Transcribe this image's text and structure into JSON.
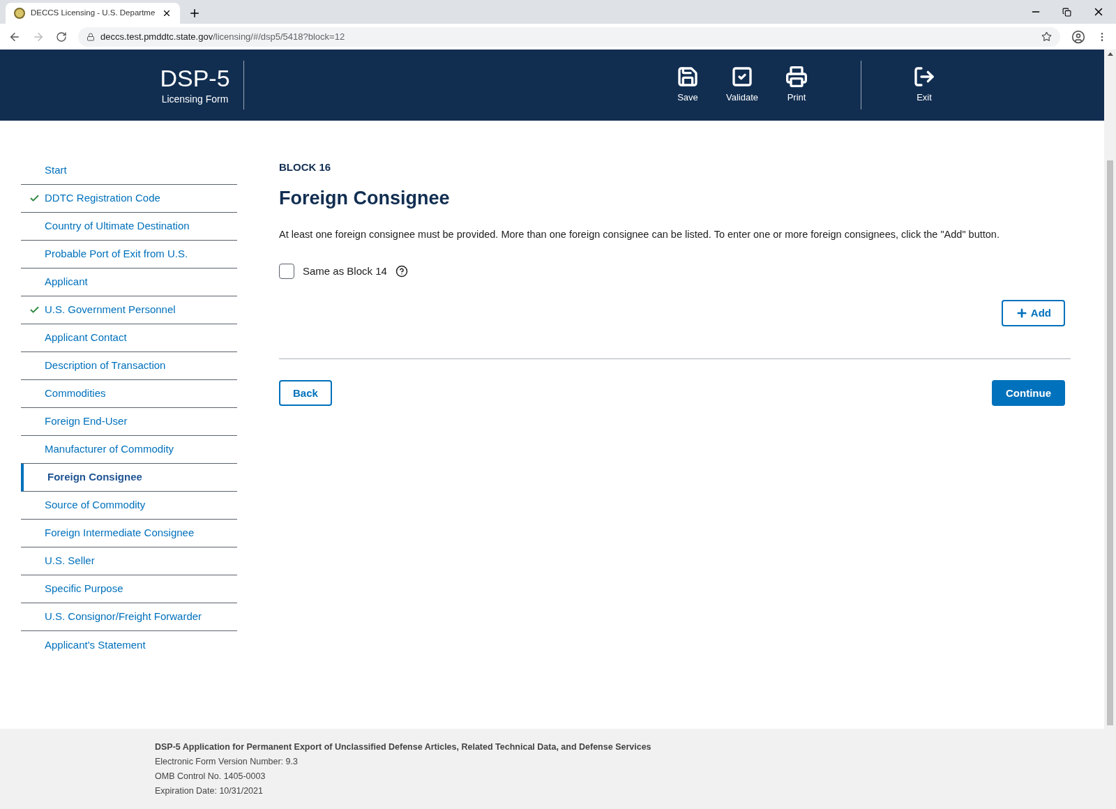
{
  "browser": {
    "tab_title": "DECCS Licensing - U.S. Departme",
    "url_host": "deccs.test.pmddtc.state.gov",
    "url_path": "/licensing/#/dsp5/5418?block=12"
  },
  "header": {
    "title": "DSP-5",
    "subtitle": "Licensing Form",
    "actions": [
      {
        "kind": "save",
        "label": "Save"
      },
      {
        "kind": "validate",
        "label": "Validate"
      },
      {
        "kind": "print",
        "label": "Print"
      }
    ],
    "exit": {
      "label": "Exit"
    }
  },
  "sidebar": {
    "items": [
      {
        "label": "Start",
        "checked": false,
        "selected": false
      },
      {
        "label": "DDTC Registration Code",
        "checked": true,
        "selected": false
      },
      {
        "label": "Country of Ultimate Destination",
        "checked": false,
        "selected": false
      },
      {
        "label": "Probable Port of Exit from U.S.",
        "checked": false,
        "selected": false
      },
      {
        "label": "Applicant",
        "checked": false,
        "selected": false
      },
      {
        "label": "U.S. Government Personnel",
        "checked": true,
        "selected": false
      },
      {
        "label": "Applicant Contact",
        "checked": false,
        "selected": false
      },
      {
        "label": "Description of Transaction",
        "checked": false,
        "selected": false
      },
      {
        "label": "Commodities",
        "checked": false,
        "selected": false
      },
      {
        "label": "Foreign End-User",
        "checked": false,
        "selected": false
      },
      {
        "label": "Manufacturer of Commodity",
        "checked": false,
        "selected": false
      },
      {
        "label": "Foreign Consignee",
        "checked": false,
        "selected": true
      },
      {
        "label": "Source of Commodity",
        "checked": false,
        "selected": false
      },
      {
        "label": "Foreign Intermediate Consignee",
        "checked": false,
        "selected": false
      },
      {
        "label": "U.S. Seller",
        "checked": false,
        "selected": false
      },
      {
        "label": "Specific Purpose",
        "checked": false,
        "selected": false
      },
      {
        "label": "U.S. Consignor/Freight Forwarder",
        "checked": false,
        "selected": false
      },
      {
        "label": "Applicant's Statement",
        "checked": false,
        "selected": false
      }
    ]
  },
  "content": {
    "block": "BLOCK 16",
    "title": "Foreign Consignee",
    "description": "At least one foreign consignee must be provided. More than one foreign consignee can be listed. To enter one or more foreign consignees, click the \"Add\" button.",
    "same_as": {
      "label": "Same as Block 14",
      "checked": false
    },
    "add_button": "Add",
    "back_button": "Back",
    "continue_button": "Continue"
  },
  "footer": {
    "title": "DSP-5 Application for Permanent Export of Unclassified Defense Articles, Related Technical Data, and Defense Services",
    "lines": [
      "Electronic Form Version Number: 9.3",
      "OMB Control No. 1405-0003",
      "Expiration Date: 10/31/2021"
    ]
  }
}
